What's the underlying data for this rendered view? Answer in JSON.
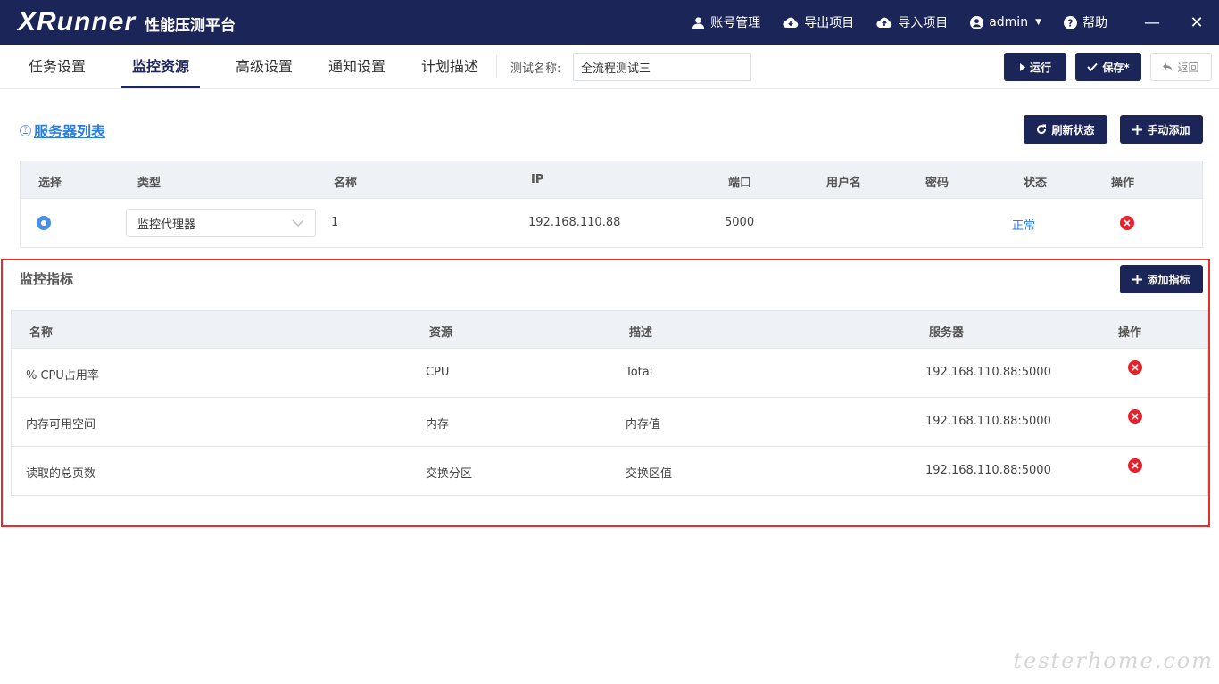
{
  "topbar": {
    "logo": "XRunner",
    "title": "性能压测平台",
    "account": "账号管理",
    "export": "导出项目",
    "import": "导入项目",
    "user": "admin",
    "help": "帮助",
    "minimize": "—",
    "close": "✕"
  },
  "tabs": [
    {
      "label": "任务设置"
    },
    {
      "label": "监控资源"
    },
    {
      "label": "高级设置"
    },
    {
      "label": "通知设置"
    },
    {
      "label": "计划描述"
    }
  ],
  "testname": {
    "label": "测试名称:",
    "value": "全流程测试三"
  },
  "toolbar": {
    "run": "运行",
    "save": "保存*",
    "back": "返回"
  },
  "servers": {
    "title": "服务器列表",
    "refresh": "刷新状态",
    "add": "手动添加",
    "headers": [
      "选择",
      "类型",
      "名称",
      "IP",
      "端口",
      "用户名",
      "密码",
      "状态",
      "操作"
    ],
    "rows": [
      {
        "type": "监控代理器",
        "name": "1",
        "ip": "192.168.110.88",
        "port": "5000",
        "username": "",
        "password": "",
        "status": "正常"
      }
    ]
  },
  "metrics": {
    "title": "监控指标",
    "add": "添加指标",
    "headers": [
      "名称",
      "资源",
      "描述",
      "服务器",
      "操作"
    ],
    "rows": [
      {
        "name": "% CPU占用率",
        "resource": "CPU",
        "desc": "Total",
        "server": "192.168.110.88:5000"
      },
      {
        "name": "内存可用空间",
        "resource": "内存",
        "desc": "内存值",
        "server": "192.168.110.88:5000"
      },
      {
        "name": "读取的总页数",
        "resource": "交换分区",
        "desc": "交换区值",
        "server": "192.168.110.88:5000"
      }
    ]
  },
  "watermark": "testerhome.com"
}
